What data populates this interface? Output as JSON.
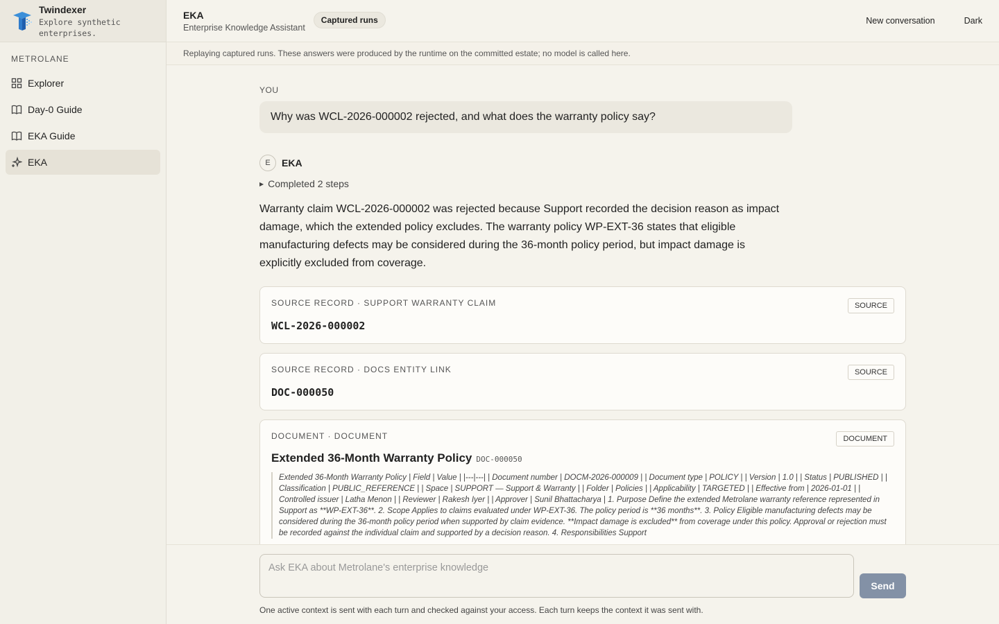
{
  "brand": {
    "name": "Twindexer",
    "tagline": "Explore synthetic enterprises."
  },
  "sidebar": {
    "workspace": "METROLANE",
    "items": [
      {
        "label": "Explorer",
        "icon": "grid-icon"
      },
      {
        "label": "Day-0 Guide",
        "icon": "book-icon"
      },
      {
        "label": "EKA Guide",
        "icon": "book-icon"
      },
      {
        "label": "EKA",
        "icon": "sparkle-icon",
        "active": true
      }
    ]
  },
  "header": {
    "title": "EKA",
    "subtitle": "Enterprise Knowledge Assistant",
    "mode_pill": "Captured runs",
    "new_conversation": "New conversation",
    "theme_toggle": "Dark"
  },
  "notice": "Replaying captured runs. These answers were produced by the runtime on the committed estate; no model is called here.",
  "conversation": {
    "you_label": "YOU",
    "question": "Why was WCL-2026-000002 rejected, and what does the warranty policy say?",
    "assistant": {
      "avatar": "E",
      "name": "EKA",
      "steps": "Completed 2 steps",
      "answer": "Warranty claim WCL-2026-000002 was rejected because Support recorded the decision reason as impact damage, which the extended policy excludes. The warranty policy WP-EXT-36 states that eligible manufacturing defects may be considered during the 36-month policy period, but impact damage is explicitly excluded from coverage."
    },
    "sources": [
      {
        "label": "SOURCE RECORD · SUPPORT WARRANTY CLAIM",
        "id": "WCL-2026-000002",
        "badge": "SOURCE"
      },
      {
        "label": "SOURCE RECORD · DOCS ENTITY LINK",
        "id": "DOC-000050",
        "badge": "SOURCE"
      }
    ],
    "document": {
      "label": "DOCUMENT · DOCUMENT",
      "badge": "DOCUMENT",
      "title": "Extended 36-Month Warranty Policy",
      "id": "DOC-000050",
      "excerpt": "Extended 36-Month Warranty Policy | Field | Value | |---|---| | Document number | DOCM-2026-000009 | | Document type | POLICY | | Version | 1.0 | | Status | PUBLISHED | | Classification | PUBLIC_REFERENCE | | Space | SUPPORT — Support & Warranty | | Folder | Policies | | Applicability | TARGETED | | Effective from | 2026-01-01 | | Controlled issuer | Latha Menon | | Reviewer | Rakesh Iyer | | Approver | Sunil Bhattacharya | 1. Purpose Define the extended Metrolane warranty reference represented in Support as **WP-EXT-36**. 2. Scope Applies to claims evaluated under WP-EXT-36. The policy period is **36 months**. 3. Policy Eligible manufacturing defects may be considered during the 36-month policy period when supported by claim evidence. **Impact damage is excluded** from coverage under this policy. Approval or rejection must be recorded against the individual claim and supported by a decision reason. 4. Responsibilities Support"
    }
  },
  "composer": {
    "placeholder": "Ask EKA about Metrolane's enterprise knowledge",
    "send": "Send",
    "hint": "One active context is sent with each turn and checked against your access. Each turn keeps the context it was sent with."
  }
}
